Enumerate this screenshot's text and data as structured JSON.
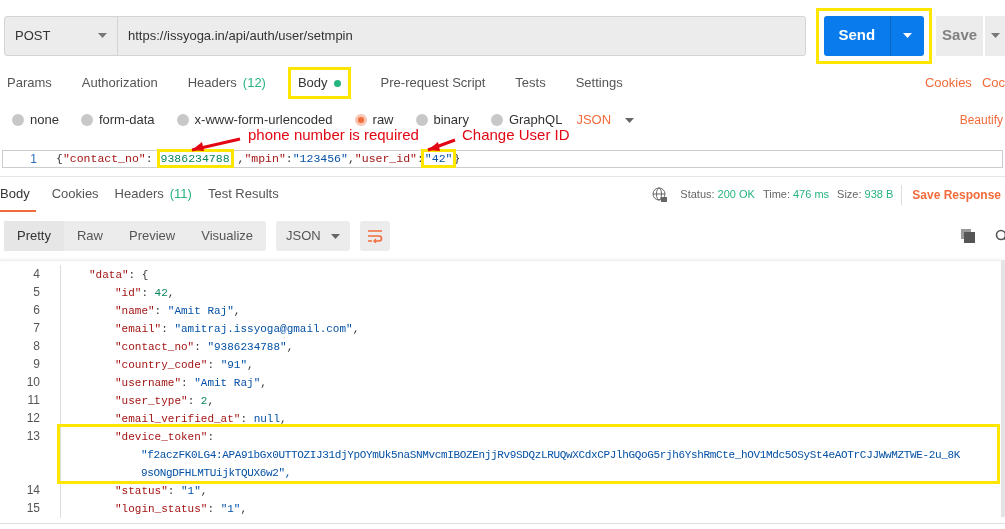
{
  "request": {
    "method": "POST",
    "url": "https://issyoga.in/api/auth/user/setmpin",
    "send": {
      "label": "Send",
      "highlighted": true
    },
    "save": "Save"
  },
  "request_tabs": [
    {
      "label": "Params",
      "selected": false
    },
    {
      "label": "Authorization",
      "selected": false
    },
    {
      "label": "Headers",
      "count": "(12)",
      "selected": false
    },
    {
      "label": "Body",
      "dot": true,
      "selected": true,
      "highlighted": true
    },
    {
      "label": "Pre-request Script",
      "selected": false
    },
    {
      "label": "Tests",
      "selected": false
    },
    {
      "label": "Settings",
      "selected": false
    }
  ],
  "request_links": [
    "Cookies",
    "Coc"
  ],
  "body_types": [
    {
      "label": "none",
      "selected": false
    },
    {
      "label": "form-data",
      "selected": false
    },
    {
      "label": "x-www-form-urlencoded",
      "selected": false
    },
    {
      "label": "raw",
      "selected": true
    },
    {
      "label": "binary",
      "selected": false
    },
    {
      "label": "GraphQL",
      "selected": false
    }
  ],
  "body_format": "JSON",
  "beautify": "Beautify",
  "annotations": [
    {
      "text": "phone number is required"
    },
    {
      "text": "Change User ID"
    }
  ],
  "request_body": {
    "number": "1",
    "parts": [
      {
        "kind": "punct",
        "text": "{"
      },
      {
        "kind": "key",
        "text": "\"contact_no\""
      },
      {
        "kind": "punct",
        "text": ": "
      },
      {
        "kind": "number",
        "text": "9386234788",
        "highlighted": true
      },
      {
        "kind": "punct",
        "text": " ,"
      },
      {
        "kind": "key",
        "text": "\"mpin\""
      },
      {
        "kind": "punct",
        "text": ":"
      },
      {
        "kind": "string",
        "text": "\"123456\""
      },
      {
        "kind": "punct",
        "text": ","
      },
      {
        "kind": "key",
        "text": "\"user_id\""
      },
      {
        "kind": "punct",
        "text": ":"
      },
      {
        "kind": "string",
        "text": "\"42\"",
        "highlighted": true
      },
      {
        "kind": "punct",
        "text": "}"
      }
    ]
  },
  "response_tabs": [
    {
      "label": "Body",
      "selected": true
    },
    {
      "label": "Cookies",
      "selected": false
    },
    {
      "label": "Headers",
      "count": "(11)",
      "selected": false
    },
    {
      "label": "Test Results",
      "selected": false
    }
  ],
  "response_meta": [
    {
      "label": "Status:",
      "value": "200 OK"
    },
    {
      "label": "Time:",
      "value": "476 ms"
    },
    {
      "label": "Size:",
      "value": "938 B"
    }
  ],
  "save_response": "Save Response",
  "view_modes": [
    {
      "label": "Pretty",
      "selected": true
    },
    {
      "label": "Raw",
      "selected": false
    },
    {
      "label": "Preview",
      "selected": false
    },
    {
      "label": "Visualize",
      "selected": false
    }
  ],
  "response_format": "JSON",
  "response_body": [
    {
      "number": "4",
      "parts": [
        {
          "kind": "key",
          "text": "\"data\""
        },
        {
          "kind": "punct",
          "text": ": {"
        }
      ],
      "children": [
        {
          "number": "5",
          "parts": [
            {
              "kind": "key",
              "text": "\"id\""
            },
            {
              "kind": "punct",
              "text": ": "
            },
            {
              "kind": "number",
              "text": "42"
            },
            {
              "kind": "punct",
              "text": ","
            }
          ]
        },
        {
          "number": "6",
          "parts": [
            {
              "kind": "key",
              "text": "\"name\""
            },
            {
              "kind": "punct",
              "text": ": "
            },
            {
              "kind": "string",
              "text": "\"Amit Raj\""
            },
            {
              "kind": "punct",
              "text": ","
            }
          ]
        },
        {
          "number": "7",
          "parts": [
            {
              "kind": "key",
              "text": "\"email\""
            },
            {
              "kind": "punct",
              "text": ": "
            },
            {
              "kind": "string",
              "text": "\"amitraj.issyoga@gmail.com\""
            },
            {
              "kind": "punct",
              "text": ","
            }
          ]
        },
        {
          "number": "8",
          "parts": [
            {
              "kind": "key",
              "text": "\"contact_no\""
            },
            {
              "kind": "punct",
              "text": ": "
            },
            {
              "kind": "string",
              "text": "\"9386234788\""
            },
            {
              "kind": "punct",
              "text": ","
            }
          ]
        },
        {
          "number": "9",
          "parts": [
            {
              "kind": "key",
              "text": "\"country_code\""
            },
            {
              "kind": "punct",
              "text": ": "
            },
            {
              "kind": "string",
              "text": "\"91\""
            },
            {
              "kind": "punct",
              "text": ","
            }
          ]
        },
        {
          "number": "10",
          "parts": [
            {
              "kind": "key",
              "text": "\"username\""
            },
            {
              "kind": "punct",
              "text": ": "
            },
            {
              "kind": "string",
              "text": "\"Amit Raj\""
            },
            {
              "kind": "punct",
              "text": ","
            }
          ]
        },
        {
          "number": "11",
          "parts": [
            {
              "kind": "key",
              "text": "\"user_type\""
            },
            {
              "kind": "punct",
              "text": ": "
            },
            {
              "kind": "number",
              "text": "2"
            },
            {
              "kind": "punct",
              "text": ","
            }
          ]
        },
        {
          "number": "12",
          "parts": [
            {
              "kind": "key",
              "text": "\"email_verified_at\""
            },
            {
              "kind": "punct",
              "text": ": "
            },
            {
              "kind": "null",
              "text": "null"
            },
            {
              "kind": "punct",
              "text": ","
            }
          ]
        },
        {
          "number": "13",
          "highlighted": true,
          "parts": [
            {
              "kind": "key",
              "text": "\"device_token\""
            },
            {
              "kind": "punct",
              "text": ":"
            }
          ],
          "value_lines": [
            "\"f2aczFK0LG4:APA91bGx0UTTOZIJ31djYpOYmUk5naSNMvcmIBOZEnjjRv9SDQzLRUQwXCdxCPJlhGQoG5rjh6YshRmCte_hOV1Mdc5OSySt4eAOTrCJJWwMZTWE-2u_8K",
            "9sONgDFHLMTUijkTQUX6w2\","
          ]
        },
        {
          "number": "14",
          "parts": [
            {
              "kind": "key",
              "text": "\"status\""
            },
            {
              "kind": "punct",
              "text": ": "
            },
            {
              "kind": "string",
              "text": "\"1\""
            },
            {
              "kind": "punct",
              "text": ","
            }
          ]
        },
        {
          "number": "15",
          "parts": [
            {
              "kind": "key",
              "text": "\"login_status\""
            },
            {
              "kind": "punct",
              "text": ": "
            },
            {
              "kind": "string",
              "text": "\"1\""
            },
            {
              "kind": "punct",
              "text": ","
            }
          ]
        }
      ]
    }
  ]
}
